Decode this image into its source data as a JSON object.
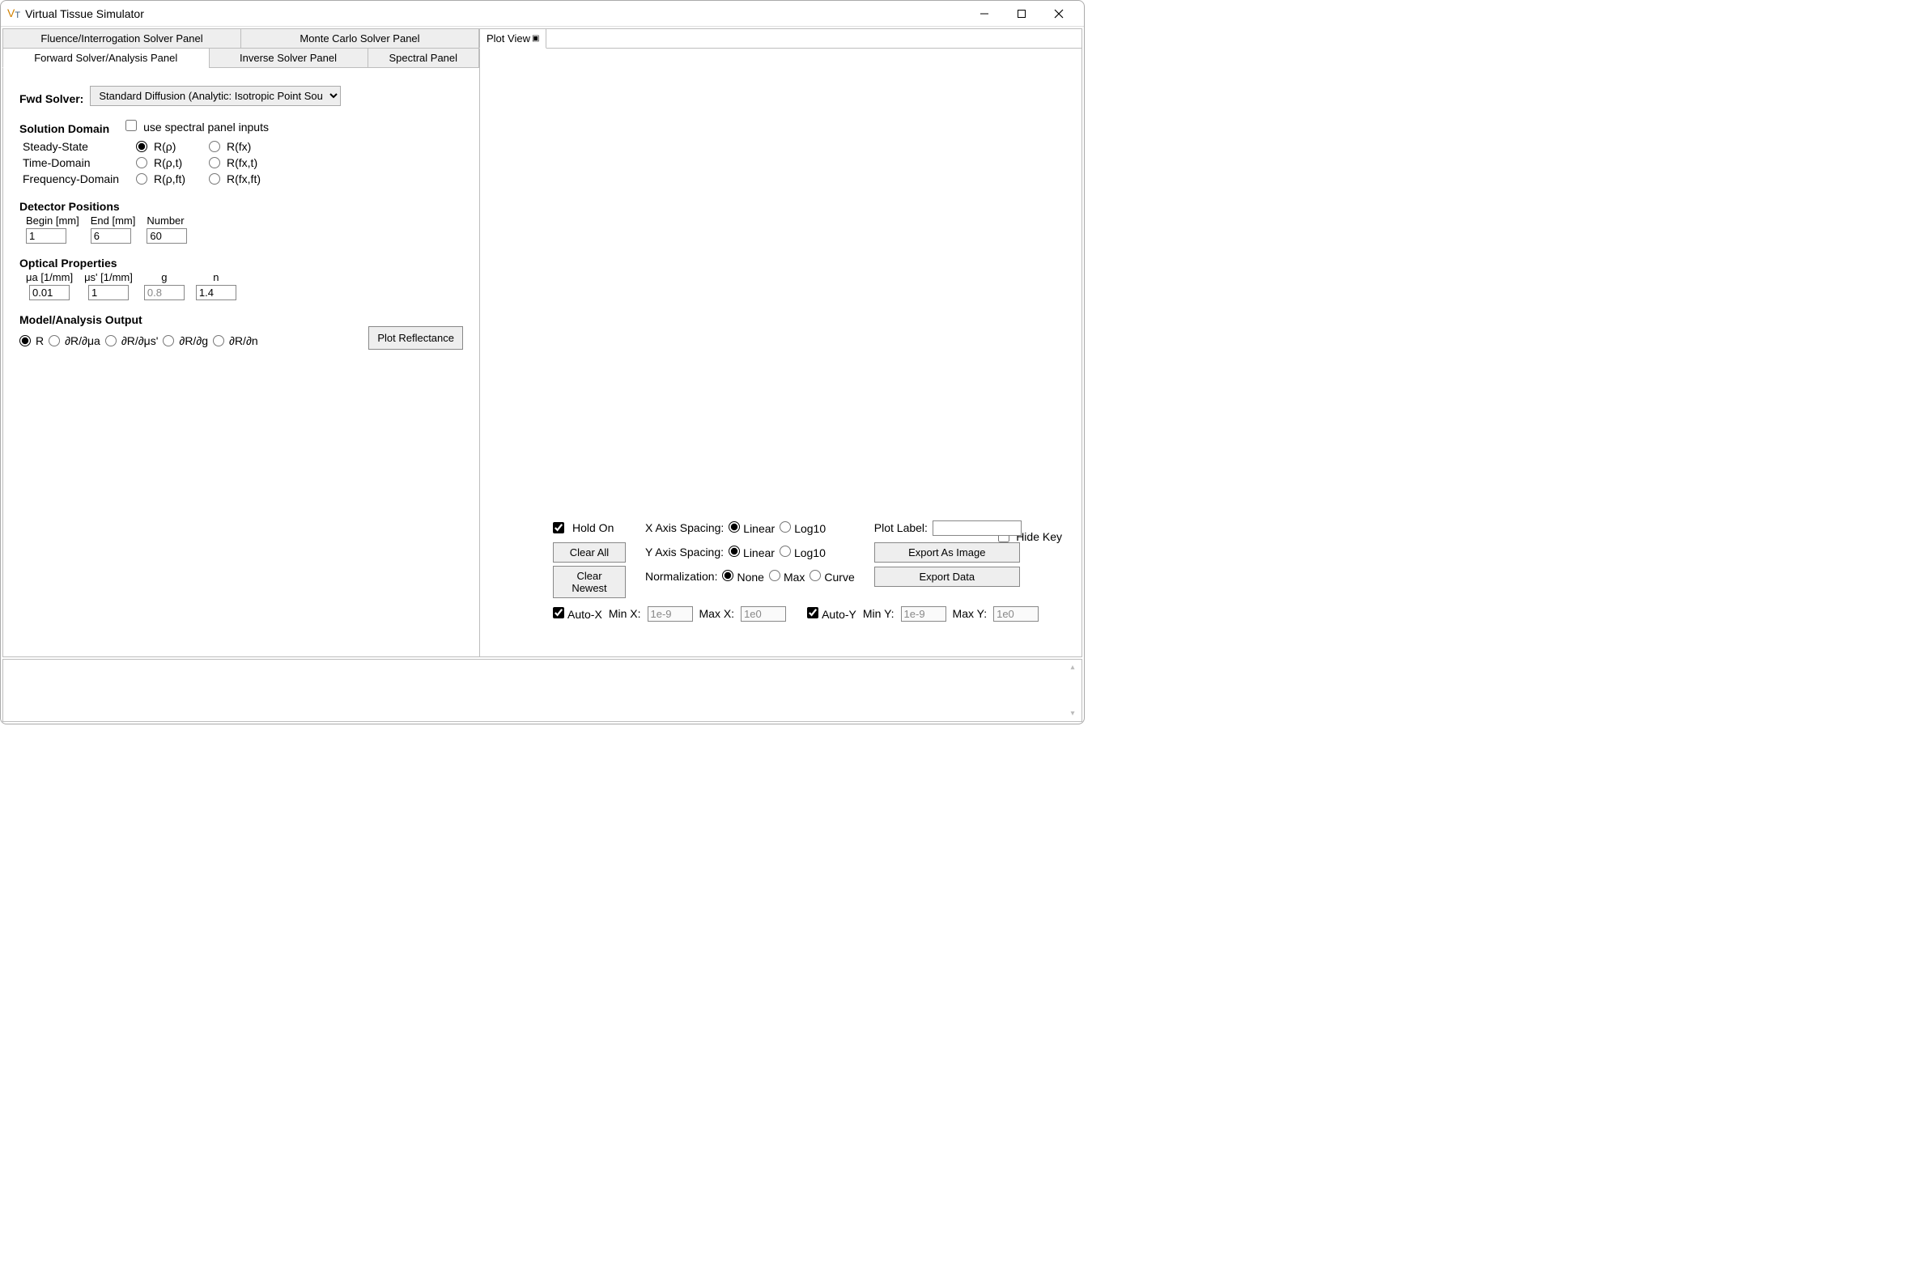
{
  "window": {
    "title": "Virtual Tissue Simulator"
  },
  "left": {
    "tab_fluence": "Fluence/Interrogation Solver Panel",
    "tab_mc": "Monte Carlo Solver Panel",
    "tab_forward": "Forward Solver/Analysis Panel",
    "tab_inverse": "Inverse Solver Panel",
    "tab_spectral": "Spectral Panel",
    "fwd_solver_label": "Fwd Solver:",
    "fwd_solver_value": "Standard Diffusion (Analytic: Isotropic Point Source)",
    "solution_domain_label": "Solution Domain",
    "use_spectral_label": "use spectral panel inputs",
    "steady_state": "Steady-State",
    "time_domain": "Time-Domain",
    "freq_domain": "Frequency-Domain",
    "r_rho": "R(ρ)",
    "r_fx": "R(fx)",
    "r_rho_t": "R(ρ,t)",
    "r_fx_t": "R(fx,t)",
    "r_rho_ft": "R(ρ,ft)",
    "r_fx_ft": "R(fx,ft)",
    "detector_positions": "Detector Positions",
    "dp_begin_label": "Begin [mm]",
    "dp_end_label": "End [mm]",
    "dp_number_label": "Number",
    "dp_begin": "1",
    "dp_end": "6",
    "dp_number": "60",
    "optical_props": "Optical Properties",
    "op_mua_label": "μa [1/mm]",
    "op_musp_label": "μs' [1/mm]",
    "op_g_label": "g",
    "op_n_label": "n",
    "op_mua": "0.01",
    "op_musp": "1",
    "op_g": "0.8",
    "op_n": "1.4",
    "model_output": "Model/Analysis Output",
    "mo_r": "R",
    "mo_drdmua": "∂R/∂μa",
    "mo_drdmusp": "∂R/∂μs'",
    "mo_drdg": "∂R/∂g",
    "mo_drdn": "∂R/∂n",
    "plot_reflectance": "Plot Reflectance"
  },
  "right": {
    "tab_plot_view": "Plot View",
    "hide_key": "Hide Key",
    "hold_on": "Hold On",
    "clear_all": "Clear All",
    "clear_newest": "Clear Newest",
    "x_spacing": "X Axis Spacing:",
    "y_spacing": "Y Axis Spacing:",
    "normalization": "Normalization:",
    "linear": "Linear",
    "log10": "Log10",
    "none": "None",
    "max": "Max",
    "curve": "Curve",
    "plot_label": "Plot Label:",
    "export_image": "Export As Image",
    "export_data": "Export Data",
    "auto_x": "Auto-X",
    "auto_y": "Auto-Y",
    "min_x": "Min X:",
    "max_x": "Max X:",
    "min_y": "Min Y:",
    "max_y": "Max Y:",
    "min_x_val": "1e-9",
    "max_x_val": "1e0",
    "min_y_val": "1e-9",
    "max_y_val": "1e0",
    "plot_label_val": ""
  }
}
